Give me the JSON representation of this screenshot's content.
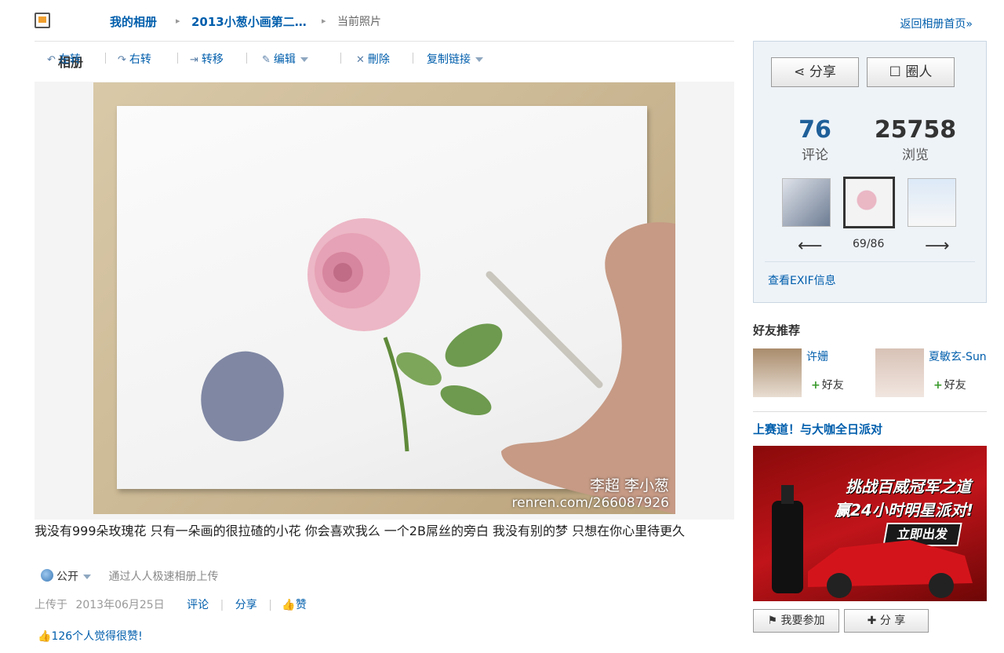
{
  "header": {
    "title": "相册",
    "crumbs": [
      "我的相册",
      "2013小葱小画第二…",
      "当前照片"
    ],
    "back_link": "返回相册首页»"
  },
  "toolbar": {
    "rotate_left": "左转",
    "rotate_right": "右转",
    "move": "转移",
    "edit": "编辑",
    "delete": "刪除",
    "copy_link": "复制链接"
  },
  "photo": {
    "watermark_name": "李超 李小葱",
    "watermark_url": "renren.com/266087926"
  },
  "caption": "我没有999朵玫瑰花 只有一朵画的很拉碴的小花 你会喜欢我么 一个2B屌丝的旁白 我没有别的梦 只想在你心里待更久",
  "meta": {
    "privacy": "公开",
    "upload_via": "通过人人极速相册上传",
    "uploaded_prefix": "上传于",
    "upload_date": "2013年06月25日",
    "comment": "评论",
    "share": "分享",
    "like": "赞",
    "likes_text": "126个人觉得很赞!"
  },
  "sidebar": {
    "share_btn": "分享",
    "tag_btn": "圈人",
    "comments_count": "76",
    "comments_label": "评论",
    "views_count": "25758",
    "views_label": "浏览",
    "prev_arrow": "⟵",
    "next_arrow": "⟶",
    "counter": "69/86",
    "exif": "查看EXIF信息",
    "friends_title": "好友推荐",
    "friends": [
      {
        "name": "许姗",
        "add": "好友"
      },
      {
        "name": "夏敏玄-Sun",
        "add": "好友"
      }
    ],
    "promo_title": "上赛道！与大咖全日派对",
    "ad": {
      "line1": "挑战百威冠军之道",
      "line2": "赢24小时明星派对!",
      "button": "立即出发",
      "accent": "#c0141a"
    },
    "join_btn": "我要参加",
    "share2_btn": "分 享"
  }
}
